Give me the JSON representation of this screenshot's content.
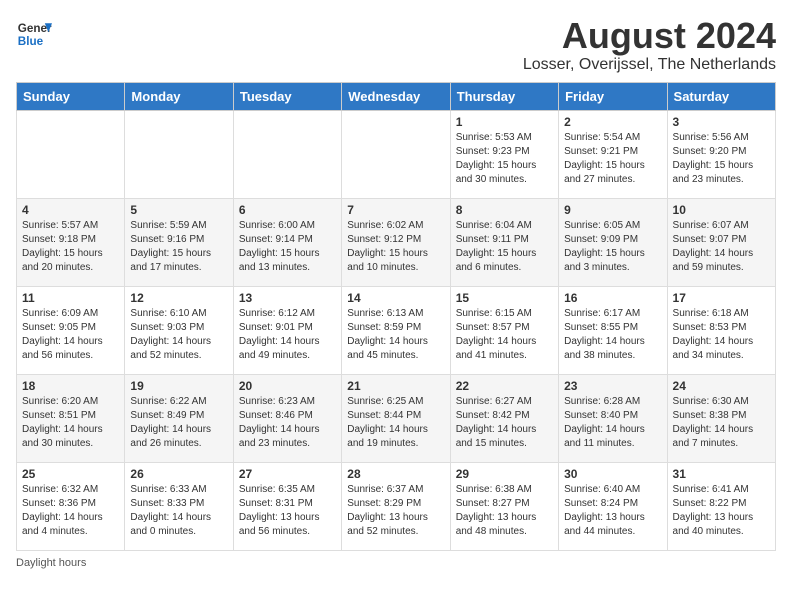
{
  "logo": {
    "general": "General",
    "blue": "Blue"
  },
  "title": "August 2024",
  "subtitle": "Losser, Overijssel, The Netherlands",
  "days_of_week": [
    "Sunday",
    "Monday",
    "Tuesday",
    "Wednesday",
    "Thursday",
    "Friday",
    "Saturday"
  ],
  "weeks": [
    [
      {
        "day": "",
        "info": ""
      },
      {
        "day": "",
        "info": ""
      },
      {
        "day": "",
        "info": ""
      },
      {
        "day": "",
        "info": ""
      },
      {
        "day": "1",
        "sunrise": "5:53 AM",
        "sunset": "9:23 PM",
        "daylight": "15 hours and 30 minutes."
      },
      {
        "day": "2",
        "sunrise": "5:54 AM",
        "sunset": "9:21 PM",
        "daylight": "15 hours and 27 minutes."
      },
      {
        "day": "3",
        "sunrise": "5:56 AM",
        "sunset": "9:20 PM",
        "daylight": "15 hours and 23 minutes."
      }
    ],
    [
      {
        "day": "4",
        "sunrise": "5:57 AM",
        "sunset": "9:18 PM",
        "daylight": "15 hours and 20 minutes."
      },
      {
        "day": "5",
        "sunrise": "5:59 AM",
        "sunset": "9:16 PM",
        "daylight": "15 hours and 17 minutes."
      },
      {
        "day": "6",
        "sunrise": "6:00 AM",
        "sunset": "9:14 PM",
        "daylight": "15 hours and 13 minutes."
      },
      {
        "day": "7",
        "sunrise": "6:02 AM",
        "sunset": "9:12 PM",
        "daylight": "15 hours and 10 minutes."
      },
      {
        "day": "8",
        "sunrise": "6:04 AM",
        "sunset": "9:11 PM",
        "daylight": "15 hours and 6 minutes."
      },
      {
        "day": "9",
        "sunrise": "6:05 AM",
        "sunset": "9:09 PM",
        "daylight": "15 hours and 3 minutes."
      },
      {
        "day": "10",
        "sunrise": "6:07 AM",
        "sunset": "9:07 PM",
        "daylight": "14 hours and 59 minutes."
      }
    ],
    [
      {
        "day": "11",
        "sunrise": "6:09 AM",
        "sunset": "9:05 PM",
        "daylight": "14 hours and 56 minutes."
      },
      {
        "day": "12",
        "sunrise": "6:10 AM",
        "sunset": "9:03 PM",
        "daylight": "14 hours and 52 minutes."
      },
      {
        "day": "13",
        "sunrise": "6:12 AM",
        "sunset": "9:01 PM",
        "daylight": "14 hours and 49 minutes."
      },
      {
        "day": "14",
        "sunrise": "6:13 AM",
        "sunset": "8:59 PM",
        "daylight": "14 hours and 45 minutes."
      },
      {
        "day": "15",
        "sunrise": "6:15 AM",
        "sunset": "8:57 PM",
        "daylight": "14 hours and 41 minutes."
      },
      {
        "day": "16",
        "sunrise": "6:17 AM",
        "sunset": "8:55 PM",
        "daylight": "14 hours and 38 minutes."
      },
      {
        "day": "17",
        "sunrise": "6:18 AM",
        "sunset": "8:53 PM",
        "daylight": "14 hours and 34 minutes."
      }
    ],
    [
      {
        "day": "18",
        "sunrise": "6:20 AM",
        "sunset": "8:51 PM",
        "daylight": "14 hours and 30 minutes."
      },
      {
        "day": "19",
        "sunrise": "6:22 AM",
        "sunset": "8:49 PM",
        "daylight": "14 hours and 26 minutes."
      },
      {
        "day": "20",
        "sunrise": "6:23 AM",
        "sunset": "8:46 PM",
        "daylight": "14 hours and 23 minutes."
      },
      {
        "day": "21",
        "sunrise": "6:25 AM",
        "sunset": "8:44 PM",
        "daylight": "14 hours and 19 minutes."
      },
      {
        "day": "22",
        "sunrise": "6:27 AM",
        "sunset": "8:42 PM",
        "daylight": "14 hours and 15 minutes."
      },
      {
        "day": "23",
        "sunrise": "6:28 AM",
        "sunset": "8:40 PM",
        "daylight": "14 hours and 11 minutes."
      },
      {
        "day": "24",
        "sunrise": "6:30 AM",
        "sunset": "8:38 PM",
        "daylight": "14 hours and 7 minutes."
      }
    ],
    [
      {
        "day": "25",
        "sunrise": "6:32 AM",
        "sunset": "8:36 PM",
        "daylight": "14 hours and 4 minutes."
      },
      {
        "day": "26",
        "sunrise": "6:33 AM",
        "sunset": "8:33 PM",
        "daylight": "14 hours and 0 minutes."
      },
      {
        "day": "27",
        "sunrise": "6:35 AM",
        "sunset": "8:31 PM",
        "daylight": "13 hours and 56 minutes."
      },
      {
        "day": "28",
        "sunrise": "6:37 AM",
        "sunset": "8:29 PM",
        "daylight": "13 hours and 52 minutes."
      },
      {
        "day": "29",
        "sunrise": "6:38 AM",
        "sunset": "8:27 PM",
        "daylight": "13 hours and 48 minutes."
      },
      {
        "day": "30",
        "sunrise": "6:40 AM",
        "sunset": "8:24 PM",
        "daylight": "13 hours and 44 minutes."
      },
      {
        "day": "31",
        "sunrise": "6:41 AM",
        "sunset": "8:22 PM",
        "daylight": "13 hours and 40 minutes."
      }
    ]
  ],
  "footer": "Daylight hours"
}
